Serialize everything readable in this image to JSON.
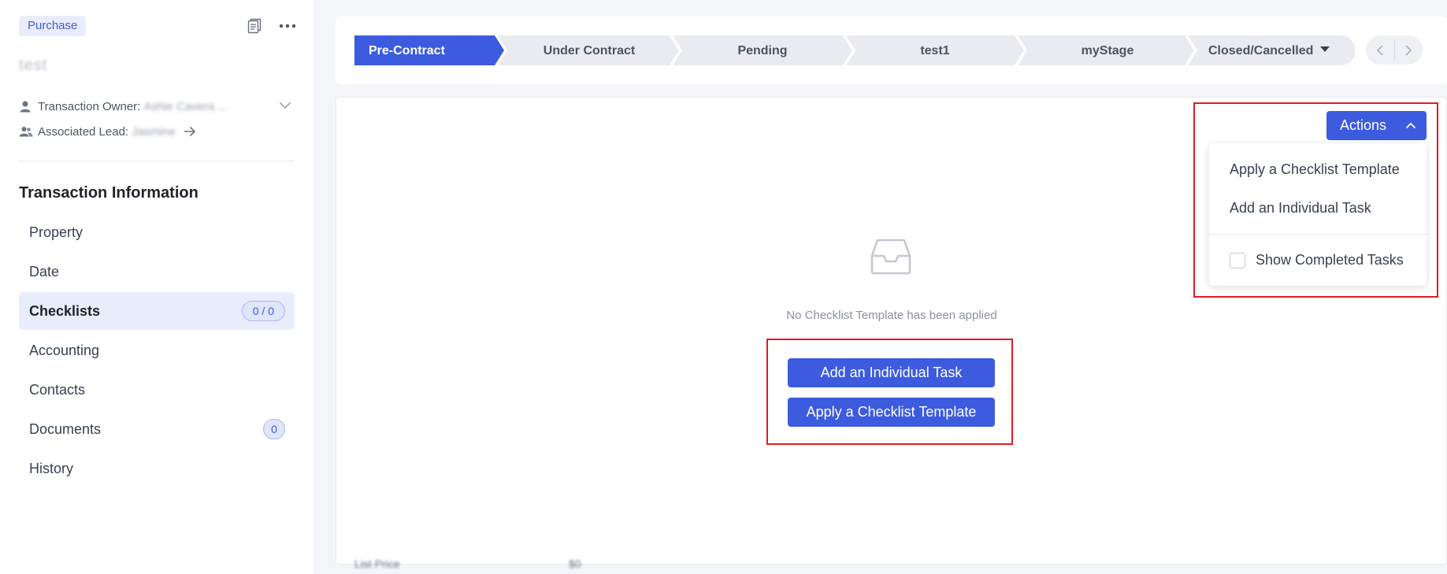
{
  "sidebar": {
    "badge": "Purchase",
    "title": "test",
    "owner_label": "Transaction Owner:",
    "owner_value": "Ashie Cavera ...",
    "lead_label": "Associated Lead:",
    "lead_value": "Jasmine",
    "section_title": "Transaction Information",
    "items": [
      {
        "label": "Property",
        "count": ""
      },
      {
        "label": "Date",
        "count": ""
      },
      {
        "label": "Checklists",
        "count": "0 / 0"
      },
      {
        "label": "Accounting",
        "count": ""
      },
      {
        "label": "Contacts",
        "count": ""
      },
      {
        "label": "Documents",
        "count": "0"
      },
      {
        "label": "History",
        "count": ""
      }
    ]
  },
  "stages": [
    {
      "label": "Pre-Contract"
    },
    {
      "label": "Under Contract"
    },
    {
      "label": "Pending"
    },
    {
      "label": "test1"
    },
    {
      "label": "myStage"
    },
    {
      "label": "Closed/Cancelled"
    }
  ],
  "main": {
    "empty_text": "No Checklist Template has been applied",
    "add_task_label": "Add an Individual Task",
    "apply_template_label": "Apply a Checklist Template",
    "actions_label": "Actions",
    "menu": {
      "apply_template": "Apply a Checklist Template",
      "add_task": "Add an Individual Task",
      "show_completed": "Show Completed Tasks"
    },
    "footer_left": "List Price",
    "footer_right": "$0"
  },
  "colors": {
    "accent": "#3d5bdf",
    "highlight": "#e01b24",
    "active_bg": "#e9edfb"
  }
}
